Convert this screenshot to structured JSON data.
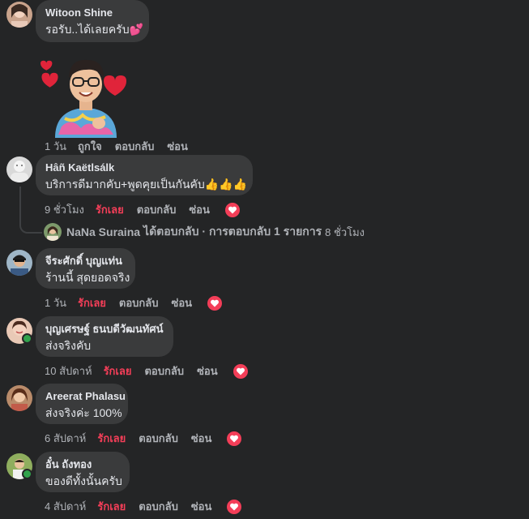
{
  "comments": [
    {
      "author": "Witoon Shine",
      "text": "รอรับ..ได้เลยครับ💕",
      "time": "1 วัน",
      "like": "ถูกใจ",
      "reply": "ตอบกลับ",
      "hide": "ซ่อน"
    },
    {
      "author": "Hâñ Kaëtlsálk",
      "text": "บริการดีมากคับ+พูดคุยเป็นกันคับ👍👍👍",
      "time": "9 ชั่วโมง",
      "like": "รักเลย",
      "reply": "ตอบกลับ",
      "hide": "ซ่อน"
    },
    {
      "author": "จีระศักดิ์ บุญแท่น",
      "text": "ร้านนี้ สุดยอดจริง",
      "time": "1 วัน",
      "like": "รักเลย",
      "reply": "ตอบกลับ",
      "hide": "ซ่อน"
    },
    {
      "author": "บุญเศรษฐ์ ธนบดีวัฒนทัศน์",
      "text": "ส่งจริงคับ",
      "time": "10 สัปดาห์",
      "like": "รักเลย",
      "reply": "ตอบกลับ",
      "hide": "ซ่อน"
    },
    {
      "author": "Areerat Phalasu",
      "text": "ส่งจริงค่ะ 100%",
      "time": "6 สัปดาห์",
      "like": "รักเลย",
      "reply": "ตอบกลับ",
      "hide": "ซ่อน"
    },
    {
      "author": "อั๋น ถังทอง",
      "text": "ของดีทั้งนั้นครับ",
      "time": "4 สัปดาห์",
      "like": "รักเลย",
      "reply": "ตอบกลับ",
      "hide": "ซ่อน"
    }
  ],
  "reply_summary": {
    "name": "NaNa Suraina",
    "text": "ได้ตอบกลับ · การตอบกลับ 1 รายการ",
    "time": "8 ชั่วโมง"
  },
  "colors": {
    "background": "#242526",
    "bubble": "#3a3b3c",
    "love": "#f33e58",
    "secondary_text": "#b0b3b8",
    "online": "#31a24c"
  },
  "icons": [
    "heart-reaction-icon",
    "online-status-icon",
    "avatar",
    "sticker"
  ]
}
